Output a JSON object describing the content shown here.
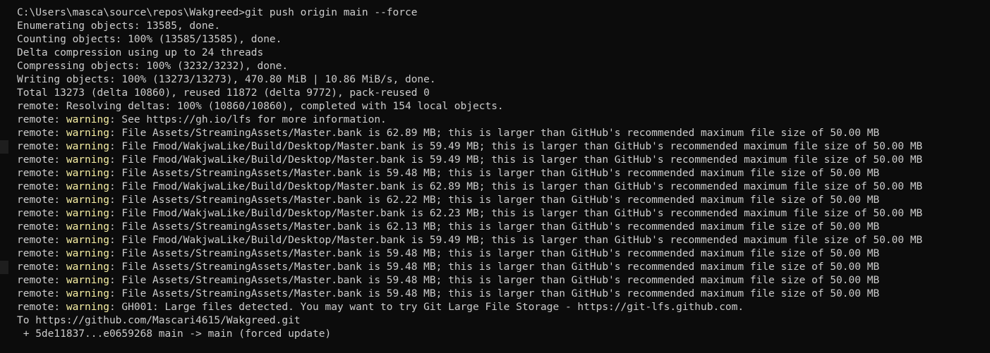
{
  "terminal": {
    "prompt": "C:\\Users\\masca\\source\\repos\\Wakgreed>",
    "command": "git push origin main --force",
    "pre_lines": [
      "Enumerating objects: 13585, done.",
      "Counting objects: 100% (13585/13585), done.",
      "Delta compression using up to 24 threads",
      "Compressing objects: 100% (3232/3232), done.",
      "Writing objects: 100% (13273/13273), 470.80 MiB | 10.86 MiB/s, done.",
      "Total 13273 (delta 10860), reused 11872 (delta 9772), pack-reused 0",
      "remote: Resolving deltas: 100% (10860/10860), completed with 154 local objects."
    ],
    "warning_prefix": "remote: ",
    "warning_label": "warning",
    "warning_lines": [
      ": See https://gh.io/lfs for more information.",
      ": File Assets/StreamingAssets/Master.bank is 62.89 MB; this is larger than GitHub's recommended maximum file size of 50.00 MB",
      ": File Fmod/WakjwaLike/Build/Desktop/Master.bank is 59.49 MB; this is larger than GitHub's recommended maximum file size of 50.00 MB",
      ": File Fmod/WakjwaLike/Build/Desktop/Master.bank is 59.49 MB; this is larger than GitHub's recommended maximum file size of 50.00 MB",
      ": File Assets/StreamingAssets/Master.bank is 59.48 MB; this is larger than GitHub's recommended maximum file size of 50.00 MB",
      ": File Fmod/WakjwaLike/Build/Desktop/Master.bank is 62.89 MB; this is larger than GitHub's recommended maximum file size of 50.00 MB",
      ": File Assets/StreamingAssets/Master.bank is 62.22 MB; this is larger than GitHub's recommended maximum file size of 50.00 MB",
      ": File Fmod/WakjwaLike/Build/Desktop/Master.bank is 62.23 MB; this is larger than GitHub's recommended maximum file size of 50.00 MB",
      ": File Assets/StreamingAssets/Master.bank is 62.13 MB; this is larger than GitHub's recommended maximum file size of 50.00 MB",
      ": File Fmod/WakjwaLike/Build/Desktop/Master.bank is 59.49 MB; this is larger than GitHub's recommended maximum file size of 50.00 MB",
      ": File Assets/StreamingAssets/Master.bank is 59.48 MB; this is larger than GitHub's recommended maximum file size of 50.00 MB",
      ": File Assets/StreamingAssets/Master.bank is 59.48 MB; this is larger than GitHub's recommended maximum file size of 50.00 MB",
      ": File Assets/StreamingAssets/Master.bank is 59.48 MB; this is larger than GitHub's recommended maximum file size of 50.00 MB",
      ": File Assets/StreamingAssets/Master.bank is 59.48 MB; this is larger than GitHub's recommended maximum file size of 50.00 MB",
      ": GH001: Large files detected. You may want to try Git Large File Storage - https://git-lfs.github.com."
    ],
    "post_lines": [
      "To https://github.com/Mascari4615/Wakgreed.git",
      " + 5de11837...e0659268 main -> main (forced update)"
    ]
  },
  "colors": {
    "background": "#0c0c0c",
    "text": "#cccccc",
    "warning": "#f9f1a5"
  }
}
